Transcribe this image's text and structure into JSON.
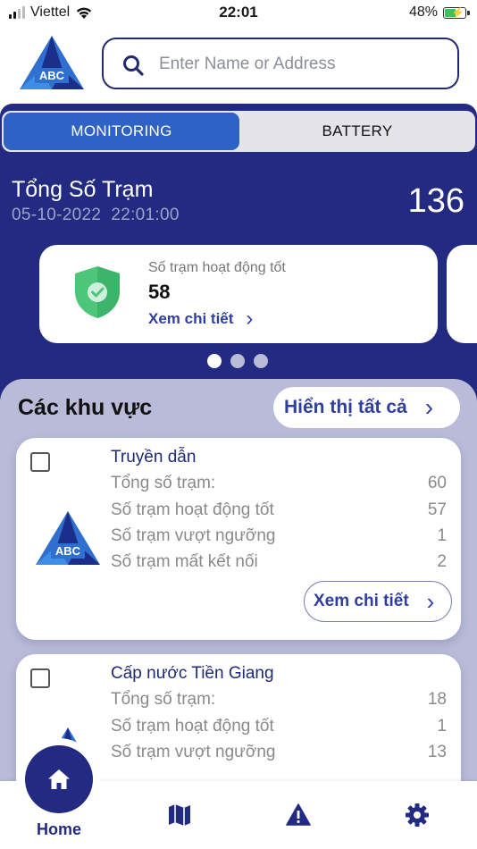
{
  "status_bar": {
    "carrier": "Viettel",
    "time": "22:01",
    "battery": "48%"
  },
  "search": {
    "placeholder": "Enter Name or Address"
  },
  "logo": {
    "text": "ABC"
  },
  "tabs": [
    {
      "label": "MONITORING",
      "active": true
    },
    {
      "label": "BATTERY",
      "active": false
    }
  ],
  "summary": {
    "title": "Tổng Số Trạm",
    "datetime": "05-10-2022  22:01:00",
    "total": "136"
  },
  "status_card": {
    "label": "Số trạm hoạt động tốt",
    "value": "58",
    "link": "Xem chi tiết",
    "link_arrow": "›"
  },
  "carousel": {
    "pages": 3,
    "active_index": 0
  },
  "areas": {
    "title": "Các khu vực",
    "show_all": "Hiển thị tất cả",
    "show_all_arrow": "›",
    "items": [
      {
        "name": "Truyền dẫn",
        "stats": [
          {
            "label": "Tổng số trạm:",
            "value": "60"
          },
          {
            "label": "Số trạm hoạt động tốt",
            "value": "57"
          },
          {
            "label": "Số trạm vượt ngưỡng",
            "value": "1"
          },
          {
            "label": "Số trạm mất kết nối",
            "value": "2"
          }
        ],
        "detail": "Xem chi tiết",
        "detail_arrow": "›"
      },
      {
        "name": "Cấp nước Tiền Giang",
        "stats": [
          {
            "label": "Tổng số trạm:",
            "value": "18"
          },
          {
            "label": "Số trạm hoạt động tốt",
            "value": "1"
          },
          {
            "label": "Số trạm vượt ngưỡng",
            "value": "13"
          }
        ]
      }
    ]
  },
  "bottom_nav": [
    {
      "label": "Home",
      "icon": "home-icon",
      "active": true
    },
    {
      "label": "",
      "icon": "map-icon"
    },
    {
      "label": "",
      "icon": "warning-icon"
    },
    {
      "label": "",
      "icon": "gear-icon"
    }
  ],
  "colors": {
    "primary": "#232a81",
    "accent": "#2e62c4",
    "link": "#2f3f9e",
    "section_bg": "#b9bbd9",
    "shield": "#4cc77a"
  }
}
